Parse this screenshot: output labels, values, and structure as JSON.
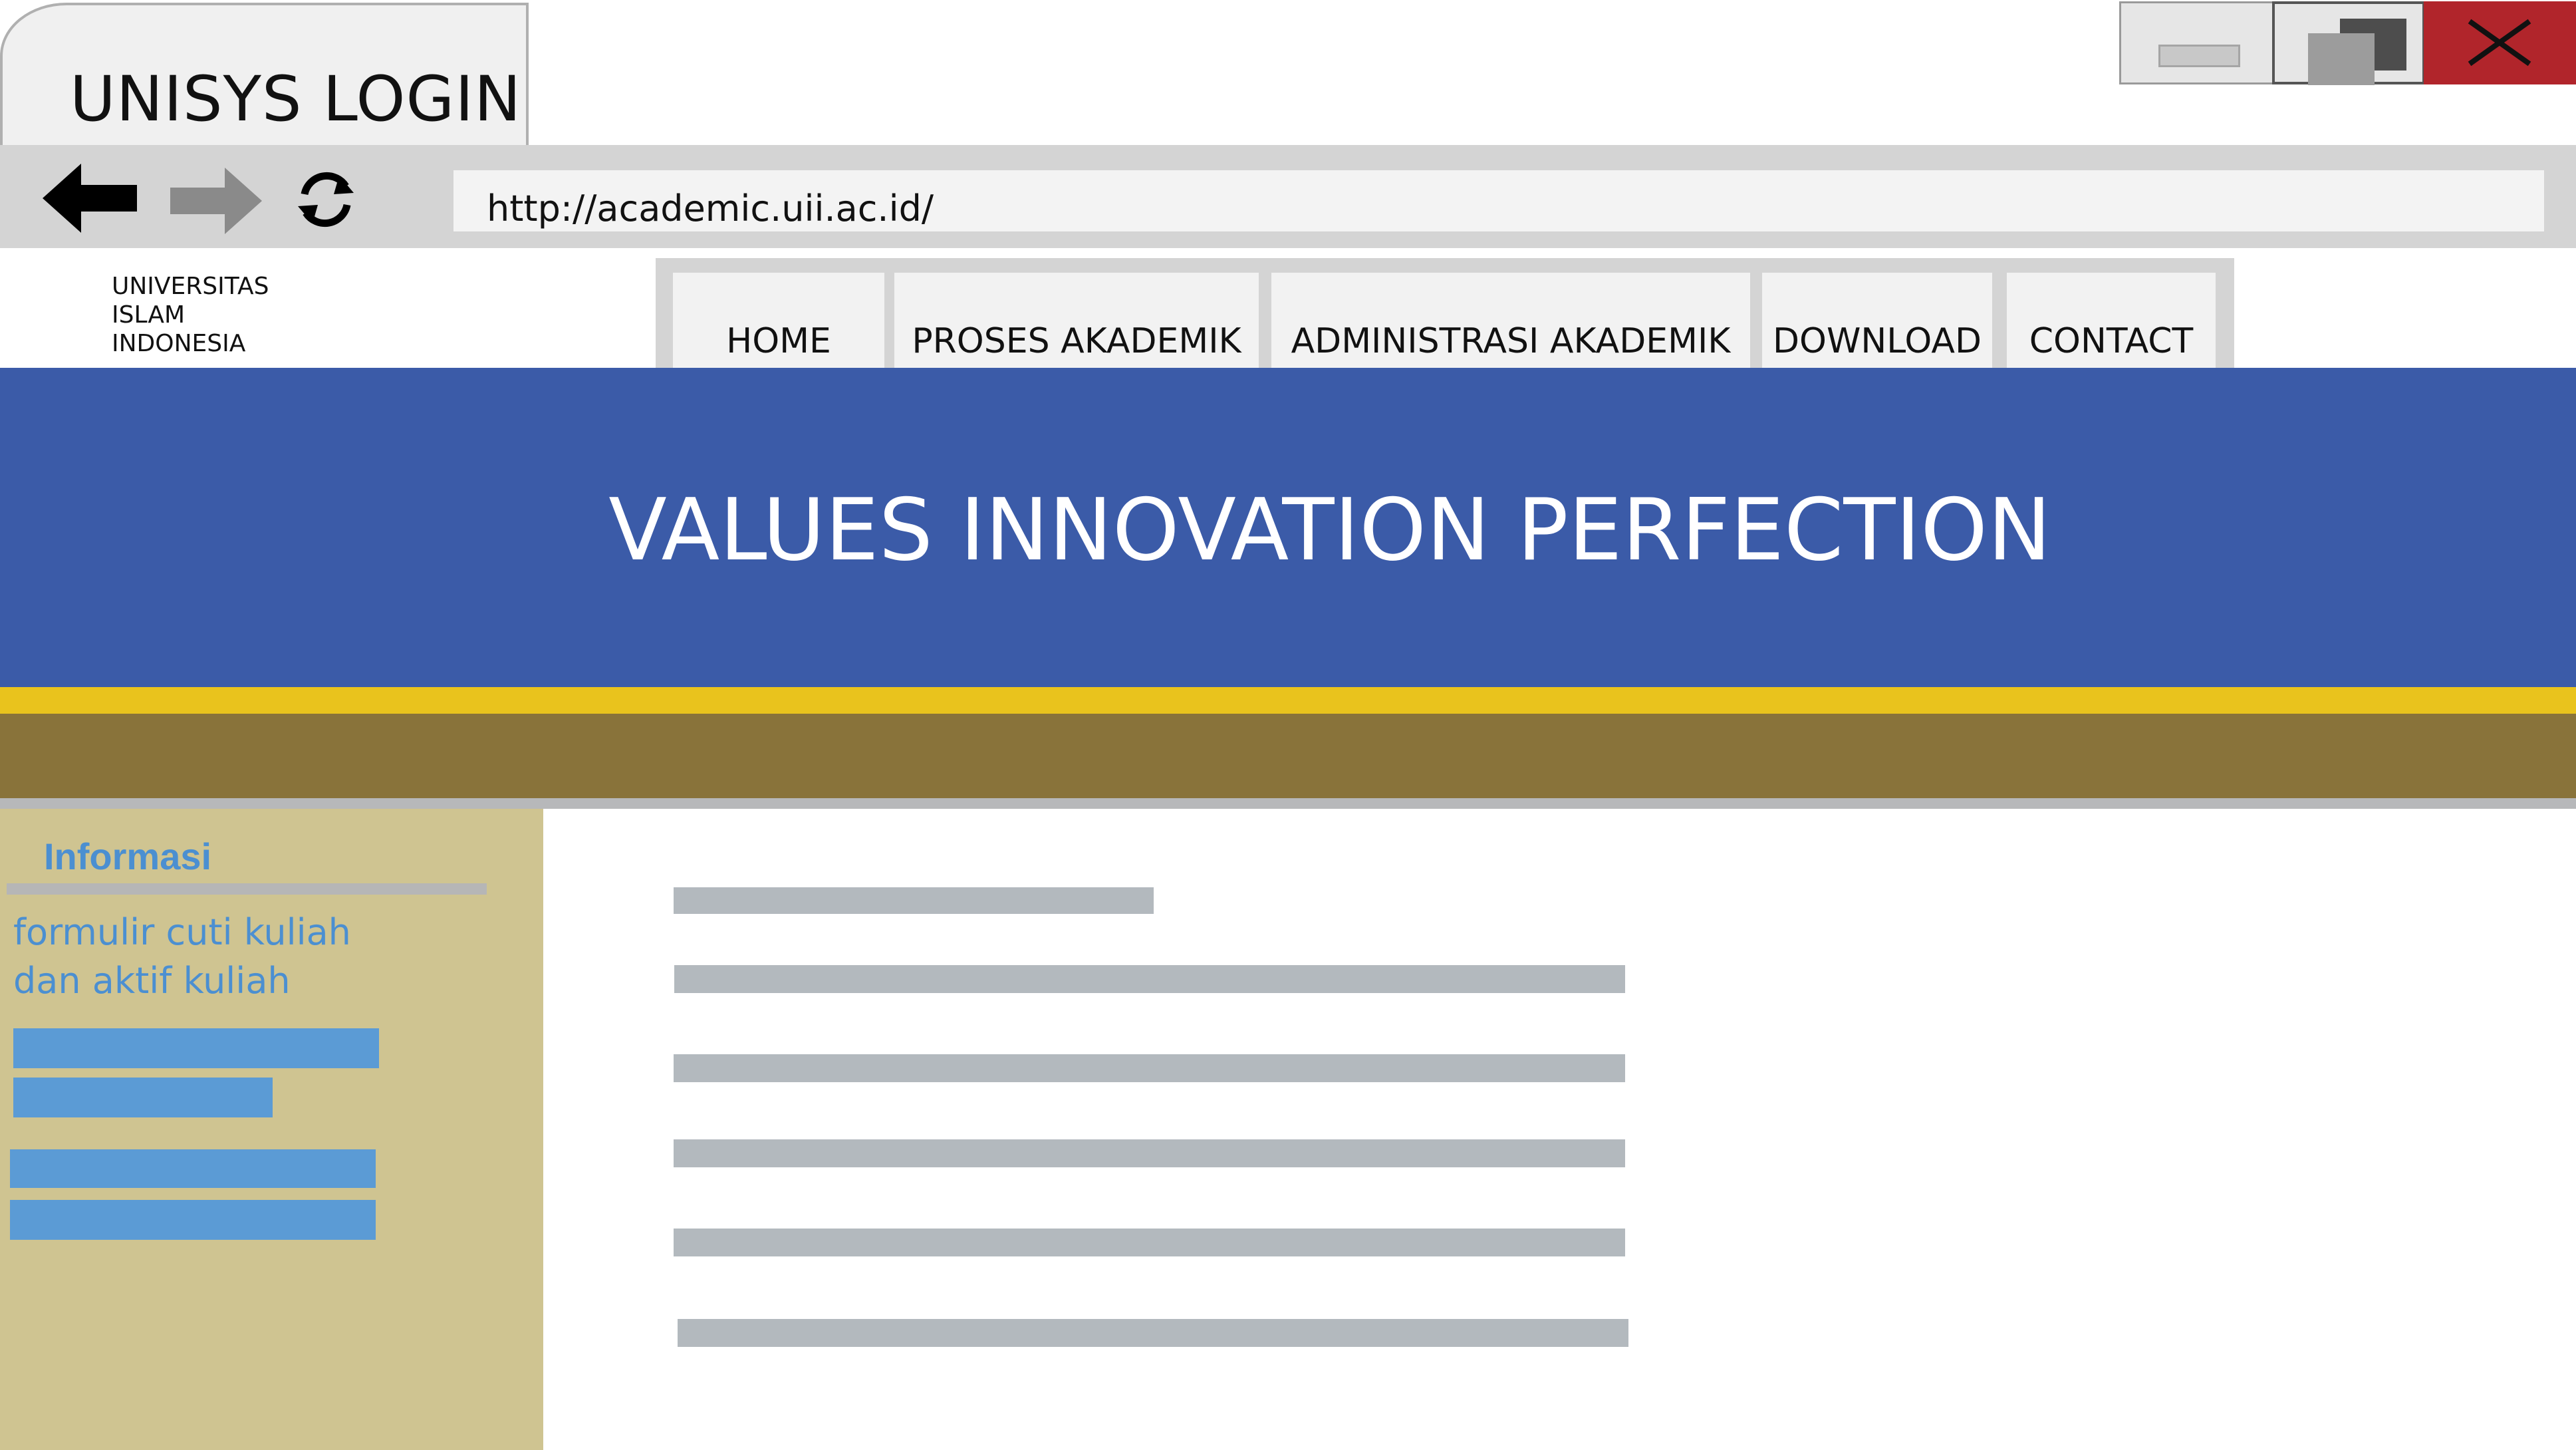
{
  "window": {
    "tab_title": "UNISYS LOGIN",
    "controls": {
      "minimize_icon": "minimize-icon",
      "maximize_icon": "restore-icon",
      "close_icon": "close-icon",
      "close_color": "#b1252b"
    }
  },
  "toolbar": {
    "back_icon": "arrow-left-icon",
    "forward_icon": "arrow-right-icon",
    "reload_icon": "reload-icon",
    "url": "http://academic.uii.ac.id/"
  },
  "site": {
    "logo_lines": [
      "UNIVERSITAS",
      "ISLAM",
      "INDONESIA"
    ],
    "nav": [
      "HOME",
      "PROSES AKADEMIK",
      "ADMINISTRASI AKADEMIK",
      "DOWNLOAD",
      "CONTACT"
    ],
    "hero_text": "VALUES INNOVATION PERFECTION",
    "colors": {
      "hero": "#3b5ba8",
      "band_yellow": "#e9c31d",
      "band_olive": "#89733a",
      "sidebar": "#cfc491",
      "link": "#4b8fd1"
    }
  },
  "sidebar": {
    "title": "Informasi",
    "link_lines": [
      "formulir cuti kuliah",
      "dan aktif kuliah"
    ]
  }
}
